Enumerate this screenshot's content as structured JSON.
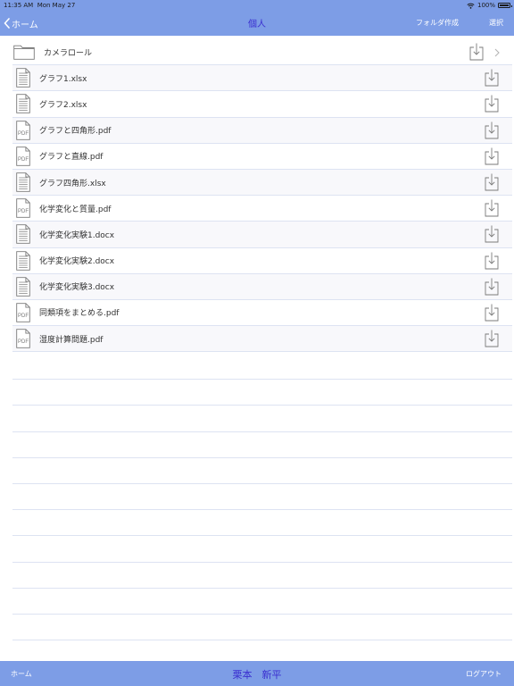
{
  "status_bar": {
    "time": "11:35 AM",
    "date": "Mon May 27",
    "battery": "100%"
  },
  "nav": {
    "back_label": "ホーム",
    "title": "個人",
    "create_folder_label": "フォルダ作成",
    "select_label": "選択"
  },
  "files": [
    {
      "name": "カメラロール",
      "icon": "folder-icon"
    },
    {
      "name": "グラフ1.xlsx",
      "icon": "document-icon"
    },
    {
      "name": "グラフ2.xlsx",
      "icon": "document-icon"
    },
    {
      "name": "グラフと四角形.pdf",
      "icon": "pdf-icon"
    },
    {
      "name": "グラフと直線.pdf",
      "icon": "pdf-icon"
    },
    {
      "name": "グラフ四角形.xlsx",
      "icon": "document-icon"
    },
    {
      "name": "化学変化と質量.pdf",
      "icon": "pdf-icon"
    },
    {
      "name": "化学変化実験1.docx",
      "icon": "document-icon"
    },
    {
      "name": "化学変化実験2.docx",
      "icon": "document-icon"
    },
    {
      "name": "化学変化実験3.docx",
      "icon": "document-icon"
    },
    {
      "name": "同類項をまとめる.pdf",
      "icon": "pdf-icon"
    },
    {
      "name": "湿度計算問題.pdf",
      "icon": "pdf-icon"
    }
  ],
  "pdf_badge_label": "PDF",
  "bottom": {
    "home_label": "ホーム",
    "user_name": "栗本　新平",
    "logout_label": "ログアウト"
  },
  "colors": {
    "bar": "#7d9de6",
    "title": "#3a2fd0",
    "divider": "#dde3f2",
    "icon_stroke": "#7a7a7a"
  }
}
